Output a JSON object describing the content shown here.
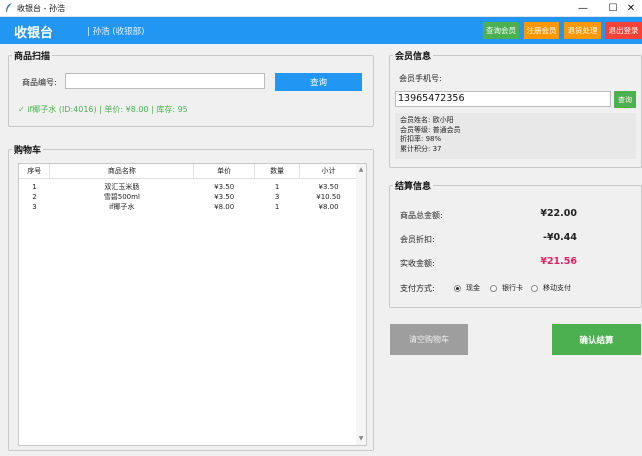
{
  "window": {
    "title": "收银台 - 孙浩",
    "minimize": "—",
    "maximize": "☐",
    "close": "✕"
  },
  "header": {
    "title": "收银台",
    "user": "| 孙浩 (收银部)",
    "buttons": {
      "query_member": "查询会员",
      "register_member": "注册会员",
      "return": "退货处理",
      "logout": "退出登录"
    },
    "colors": {
      "bar": "#2196f3",
      "green": "#4caf50",
      "orange": "#ff9800",
      "red": "#f44336"
    }
  },
  "scan": {
    "title": "商品扫描",
    "code_label": "商品编号:",
    "code_value": "",
    "query_label": "查询",
    "result": "✓ if椰子水 (ID:4016) | 单价: ¥8.00 | 库存: 95"
  },
  "cart": {
    "title": "购物车",
    "columns": [
      "序号",
      "商品名称",
      "单价",
      "数量",
      "小计"
    ],
    "rows": [
      [
        "1",
        "双汇玉米肠",
        "¥3.50",
        "1",
        "¥3.50"
      ],
      [
        "2",
        "雪碧500ml",
        "¥3.50",
        "3",
        "¥10.50"
      ],
      [
        "3",
        "if椰子水",
        "¥8.00",
        "1",
        "¥8.00"
      ]
    ],
    "scroll_up": "▲",
    "scroll_down": "▼"
  },
  "member": {
    "title": "会员信息",
    "phone_label": "会员手机号:",
    "phone_value": "13965472356",
    "query_label": "查询",
    "info": {
      "name": "会员姓名: 欧小阳",
      "level": "会员等级: 普通会员",
      "discount": "折扣率: 98%",
      "points": "累计积分: 37"
    }
  },
  "settle": {
    "title": "结算信息",
    "total_label": "商品总金额:",
    "total_value": "¥22.00",
    "discount_label": "会员折扣:",
    "discount_value": "-¥0.44",
    "pay_label": "实收金额:",
    "pay_value": "¥21.56",
    "method_label": "支付方式:",
    "methods": [
      "现金",
      "银行卡",
      "移动支付"
    ],
    "selected_method": "现金"
  },
  "actions": {
    "clear": "清空购物车",
    "confirm": "确认结算"
  }
}
